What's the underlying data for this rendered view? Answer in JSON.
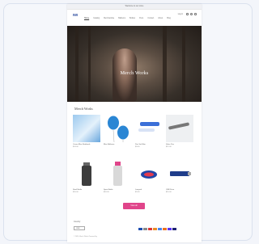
{
  "announcement": "Welcome to our store",
  "header": {
    "logo": "IWI",
    "nav": [
      "Home",
      "Catalog",
      "Merchandise",
      "Balloons",
      "Bottles",
      "Pens",
      "Contact",
      "About",
      "Blog"
    ],
    "login": "Log in"
  },
  "hero": {
    "title": "Merch Works"
  },
  "section": {
    "title": "Merch Works"
  },
  "products": [
    {
      "name": "Ocean Blue Notebook",
      "price": "$24.00"
    },
    {
      "name": "Blue Balloons",
      "price": ""
    },
    {
      "name": "Pen Set Blue",
      "price": "$9.00"
    },
    {
      "name": "Silver Pen",
      "price": "$12.00"
    },
    {
      "name": "Steel Bottle",
      "price": "$20.00"
    },
    {
      "name": "Sport Bottle",
      "price": "$18.00"
    },
    {
      "name": "Lanyard",
      "price": "$5.00"
    },
    {
      "name": "USB Drive",
      "price": "$15.00"
    }
  ],
  "cta": "View all",
  "footer": {
    "label": "Country",
    "language": "USD",
    "copyright": "© 2024, Merch Works Powered by"
  },
  "colors": {
    "accent": "#e0458a",
    "brand": "#2b4a9e"
  }
}
